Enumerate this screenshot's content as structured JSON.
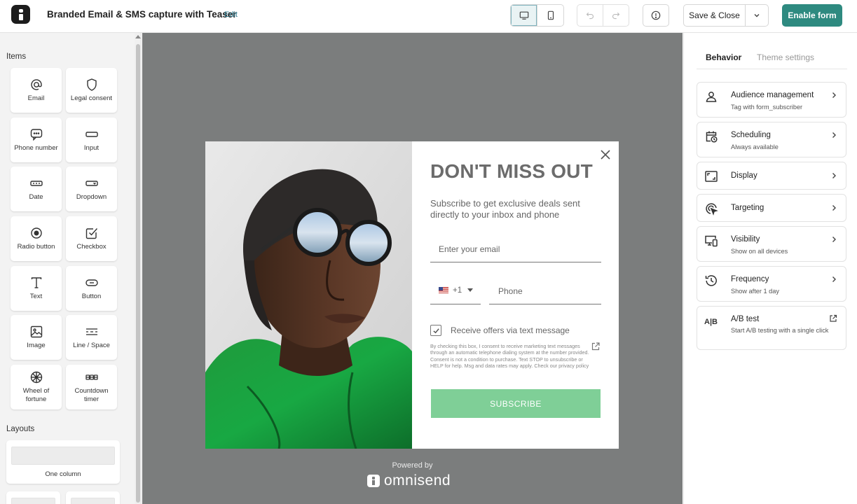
{
  "header": {
    "title": "Branded Email & SMS capture with Teaser",
    "edit_label": "Edit",
    "save_label": "Save & Close",
    "enable_label": "Enable form"
  },
  "sidebar": {
    "items_title": "Items",
    "items": [
      {
        "label": "Email",
        "icon": "at-icon"
      },
      {
        "label": "Legal consent",
        "icon": "shield-icon"
      },
      {
        "label": "Phone number",
        "icon": "chat-bubble-icon"
      },
      {
        "label": "Input",
        "icon": "input-icon"
      },
      {
        "label": "Date",
        "icon": "date-icon"
      },
      {
        "label": "Dropdown",
        "icon": "dropdown-icon"
      },
      {
        "label": "Radio button",
        "icon": "radio-icon"
      },
      {
        "label": "Checkbox",
        "icon": "checkbox-icon"
      },
      {
        "label": "Text",
        "icon": "text-icon"
      },
      {
        "label": "Button",
        "icon": "button-icon"
      },
      {
        "label": "Image",
        "icon": "image-icon"
      },
      {
        "label": "Line / Space",
        "icon": "line-space-icon"
      },
      {
        "label": "Wheel of fortune",
        "icon": "wheel-icon"
      },
      {
        "label": "Countdown timer",
        "icon": "countdown-icon"
      }
    ],
    "layouts_title": "Layouts",
    "layouts": [
      {
        "label": "One column"
      }
    ]
  },
  "popup": {
    "headline": "DON'T MISS OUT",
    "subtext": "Subscribe to get exclusive deals sent directly to your inbox and phone",
    "email_placeholder": "Enter your email",
    "country_code": "+1",
    "phone_placeholder": "Phone",
    "sms_label": "Receive offers via text message",
    "sms_checked": true,
    "disclaimer": "By checking this box, I consent to receive marketing text messages through an automatic telephone dialing system at the number provided. Consent is not a condition to purchase. Text STOP to unsubscribe or HELP for help. Msg and data rates may apply. Check our privacy policy",
    "subscribe_label": "SUBSCRIBE",
    "subscribe_color": "#7fcf97"
  },
  "canvas": {
    "powered_by": "Powered by",
    "brand": "omnisend",
    "background": "#7b7d7d"
  },
  "right_panel": {
    "tabs": [
      {
        "label": "Behavior",
        "active": true
      },
      {
        "label": "Theme settings",
        "active": false
      }
    ],
    "settings": [
      {
        "title": "Audience management",
        "subtitle": "Tag with form_subscriber",
        "icon": "user-icon"
      },
      {
        "title": "Scheduling",
        "subtitle": "Always available",
        "icon": "calendar-clock-icon"
      },
      {
        "title": "Display",
        "subtitle": "",
        "icon": "display-frame-icon"
      },
      {
        "title": "Targeting",
        "subtitle": "",
        "icon": "target-cursor-icon"
      },
      {
        "title": "Visibility",
        "subtitle": "Show on all devices",
        "icon": "devices-icon"
      },
      {
        "title": "Frequency",
        "subtitle": "Show after 1 day",
        "icon": "history-icon"
      },
      {
        "title": "A/B test",
        "subtitle": "Start A/B testing with a single click",
        "icon": "ab-icon"
      }
    ]
  },
  "colors": {
    "accent": "#2e8a80",
    "link": "#2b7a8f"
  }
}
